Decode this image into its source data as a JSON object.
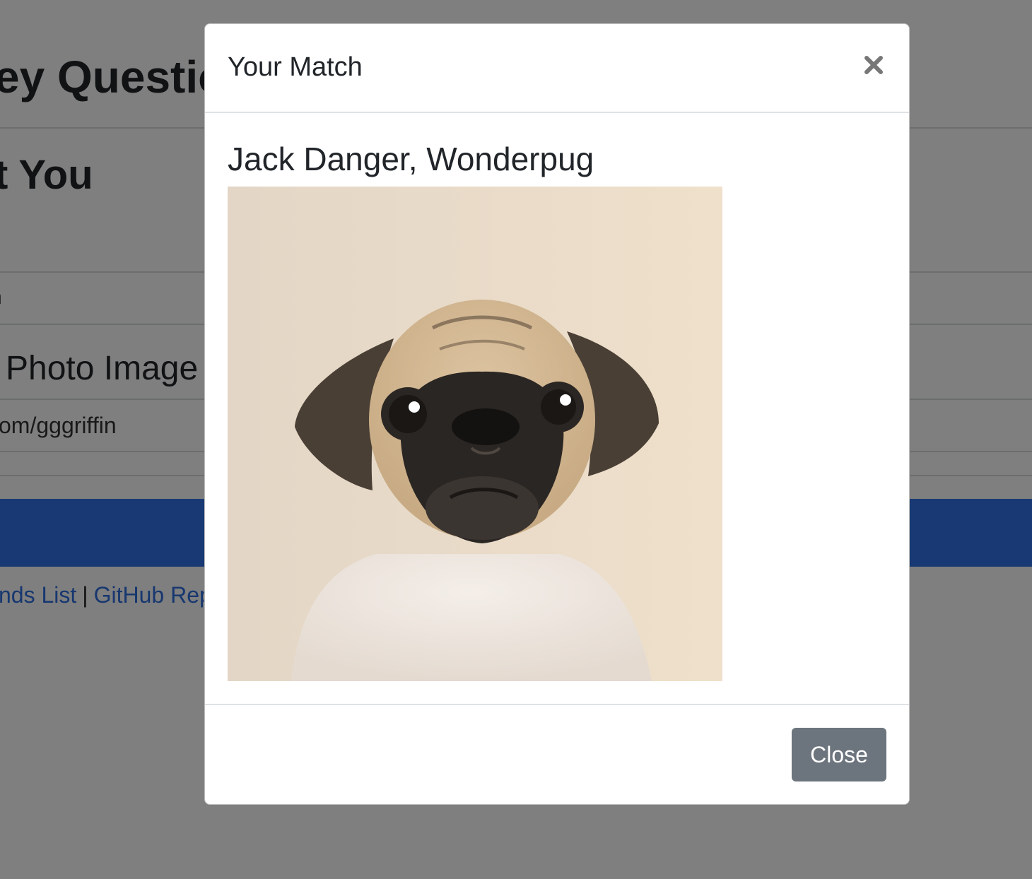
{
  "background": {
    "heading1": "ey Questio",
    "heading2": "t You",
    "field1": "n",
    "heading3": "Photo Image",
    "field2": "om/gggriffin",
    "footer": {
      "link1": "nds List",
      "separator": "|",
      "link2": "GitHub Rep"
    }
  },
  "modal": {
    "title": "Your Match",
    "close_icon": "close-icon",
    "match_name": "Jack Danger, Wonderpug",
    "photo_icon": "pug-photo",
    "close_button_label": "Close"
  },
  "colors": {
    "submit_bar": "#3173e8",
    "link": "#2f6fde",
    "close_button": "#6c757d",
    "backdrop": "rgba(0,0,0,0.5)"
  }
}
